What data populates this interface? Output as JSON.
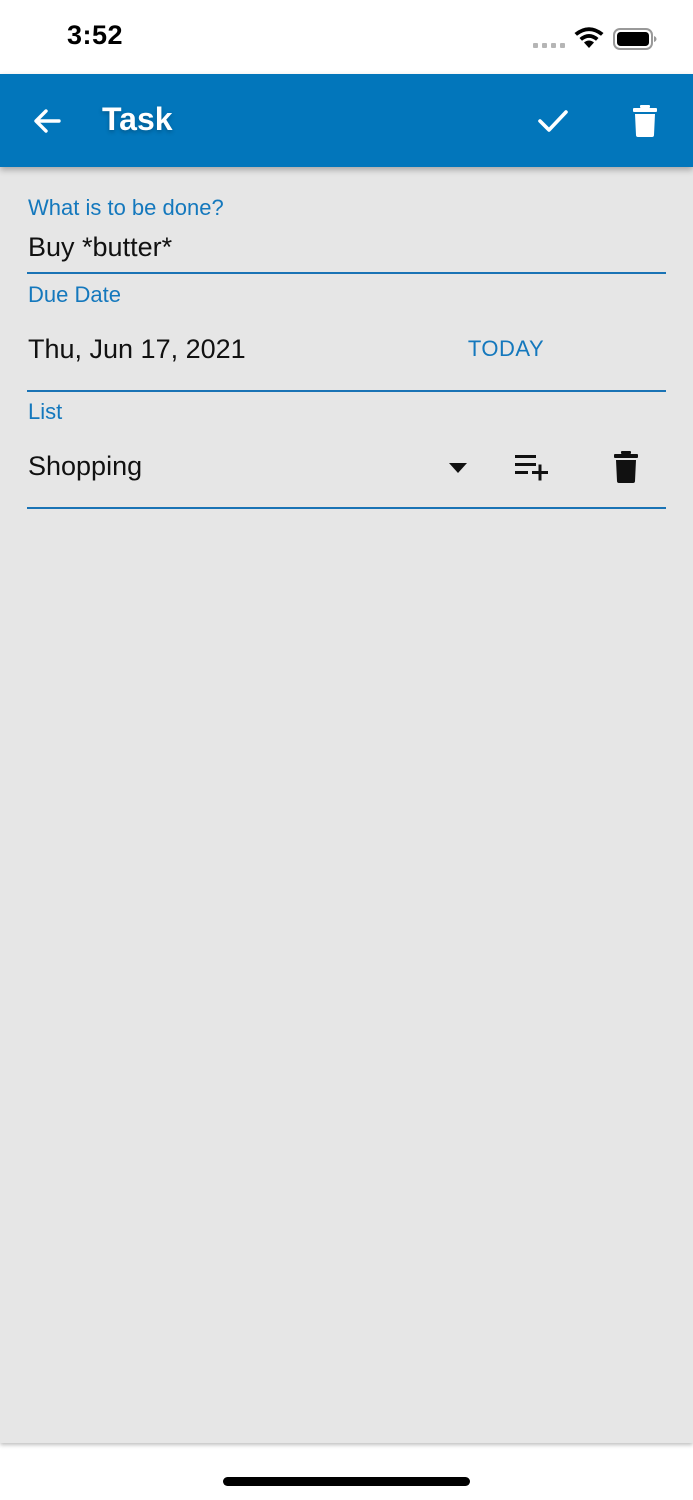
{
  "status_bar": {
    "time": "3:52",
    "icons": [
      "signal-icon",
      "wifi-icon",
      "battery-icon"
    ]
  },
  "app_bar": {
    "title": "Task",
    "back_icon": "arrow-back-icon",
    "save_icon": "check-icon",
    "delete_icon": "trash-icon",
    "background_color": "#0276bb"
  },
  "form": {
    "task_label": "What is to be done?",
    "task_value": "Buy *butter*",
    "due_label": "Due Date",
    "due_value": "Thu, Jun 17, 2021",
    "today_label": "TODAY",
    "list_label": "List",
    "list_value": "Shopping",
    "list_dropdown_icon": "dropdown-arrow-icon",
    "add_list_icon": "playlist-add-icon",
    "delete_list_icon": "trash-icon",
    "accent_color": "#1478bd"
  }
}
